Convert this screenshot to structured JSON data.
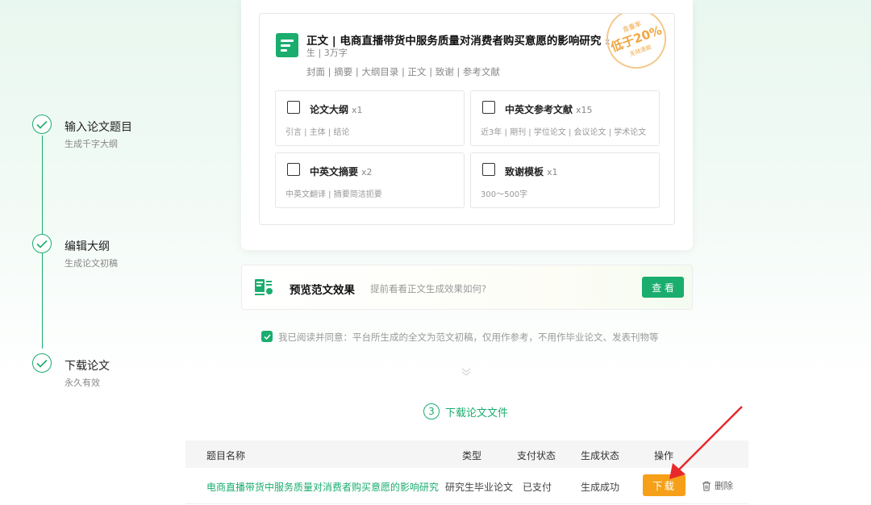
{
  "steps": [
    {
      "title": "输入论文题目",
      "sub": "生成千字大纲"
    },
    {
      "title": "编辑大纲",
      "sub": "生成论文初稿"
    },
    {
      "title": "下载论文",
      "sub": "永久有效"
    }
  ],
  "main_card": {
    "title": "正文 | 电商直播带货中服务质量对消费者购买意愿的影响研究",
    "title_suffix": "x",
    "sub": "生 | 3万字",
    "parts": "封面 | 摘要 | 大纲目录 | 正文 | 致谢 | 参考文献",
    "stamp": {
      "line1": "查重率",
      "line2": "低于20%",
      "line3": "无效退款"
    }
  },
  "features": [
    {
      "name": "论文大纲",
      "count": "x1",
      "desc": "引言 | 主体 | 结论",
      "icon": "outline-icon"
    },
    {
      "name": "中英文参考文献",
      "count": "x15",
      "desc": "近3年 | 期刊 | 学位论文 | 会议论文 | 学术论文",
      "icon": "reference-icon"
    },
    {
      "name": "中英文摘要",
      "count": "x2",
      "desc": "中英文翻译 | 摘要简洁扼要",
      "icon": "abstract-icon"
    },
    {
      "name": "致谢模板",
      "count": "x1",
      "desc": "300～500字",
      "icon": "thanks-icon"
    }
  ],
  "preview": {
    "title": "预览范文效果",
    "hint": "提前看看正文生成效果如何?",
    "button": "查 看"
  },
  "agreement": "我已阅读并同意：平台所生成的全文为范文初稿，仅用作参考，不用作毕业论文、发表刊物等",
  "section": {
    "number": "3",
    "label": "下载论文文件"
  },
  "table": {
    "headers": [
      "题目名称",
      "类型",
      "支付状态",
      "生成状态",
      "操作"
    ],
    "row": {
      "title": "电商直播带货中服务质量对消费者购买意愿的影响研究",
      "type": "研究生毕业论文",
      "pay": "已支付",
      "gen": "生成成功",
      "download": "下载",
      "delete": "删除"
    }
  },
  "colors": {
    "accent": "#1aad6e",
    "download": "#f5a018",
    "arrow": "#e8282b"
  }
}
